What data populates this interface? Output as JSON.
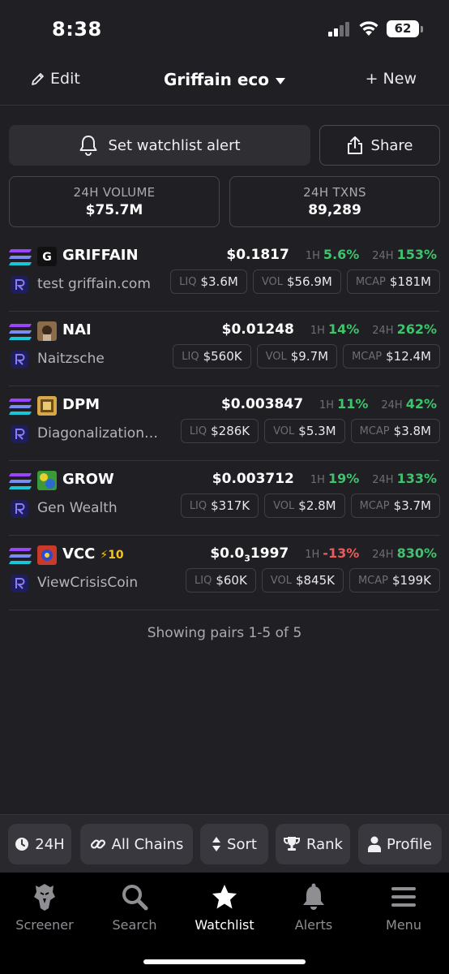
{
  "status_bar": {
    "time": "8:38",
    "battery": "62"
  },
  "header": {
    "edit_label": "Edit",
    "title": "Griffain eco",
    "new_label": "+ New"
  },
  "actions": {
    "alert_label": "Set watchlist alert",
    "share_label": "Share"
  },
  "stats": [
    {
      "label": "24H VOLUME",
      "value": "$75.7M"
    },
    {
      "label": "24H TXNS",
      "value": "89,289"
    }
  ],
  "pairs": [
    {
      "symbol": "GRIFFAIN",
      "boost": "",
      "name": "test griffain.com",
      "price": "$0.1817",
      "price_sub": "",
      "price_tail": "",
      "h1_label": "1H",
      "h1": "5.6%",
      "h1_dir": "pos",
      "h24_label": "24H",
      "h24": "153%",
      "h24_dir": "pos",
      "liq": "$3.6M",
      "vol": "$56.9M",
      "mcap": "$181M"
    },
    {
      "symbol": "NAI",
      "boost": "",
      "name": "Naitzsche",
      "price": "$0.01248",
      "price_sub": "",
      "price_tail": "",
      "h1_label": "1H",
      "h1": "14%",
      "h1_dir": "pos",
      "h24_label": "24H",
      "h24": "262%",
      "h24_dir": "pos",
      "liq": "$560K",
      "vol": "$9.7M",
      "mcap": "$12.4M"
    },
    {
      "symbol": "DPM",
      "boost": "",
      "name": "Diagonalization…",
      "price": "$0.003847",
      "price_sub": "",
      "price_tail": "",
      "h1_label": "1H",
      "h1": "11%",
      "h1_dir": "pos",
      "h24_label": "24H",
      "h24": "42%",
      "h24_dir": "pos",
      "liq": "$286K",
      "vol": "$5.3M",
      "mcap": "$3.8M"
    },
    {
      "symbol": "GROW",
      "boost": "",
      "name": "Gen Wealth",
      "price": "$0.003712",
      "price_sub": "",
      "price_tail": "",
      "h1_label": "1H",
      "h1": "19%",
      "h1_dir": "pos",
      "h24_label": "24H",
      "h24": "133%",
      "h24_dir": "pos",
      "liq": "$317K",
      "vol": "$2.8M",
      "mcap": "$3.7M"
    },
    {
      "symbol": "VCC",
      "boost": "⚡10",
      "name": "ViewCrisisCoin",
      "price": "$0.0",
      "price_sub": "3",
      "price_tail": "1997",
      "h1_label": "1H",
      "h1": "-13%",
      "h1_dir": "neg",
      "h24_label": "24H",
      "h24": "830%",
      "h24_dir": "pos",
      "liq": "$60K",
      "vol": "$845K",
      "mcap": "$199K"
    }
  ],
  "chip_labels": {
    "liq": "LIQ",
    "vol": "VOL",
    "mcap": "MCAP"
  },
  "showing": "Showing pairs 1-5 of 5",
  "filters": {
    "timeframe": "24H",
    "chains": "All Chains",
    "sort": "Sort",
    "rank": "Rank",
    "profile": "Profile"
  },
  "tabs": [
    {
      "label": "Screener",
      "icon": "eagle-icon"
    },
    {
      "label": "Search",
      "icon": "search-icon"
    },
    {
      "label": "Watchlist",
      "icon": "star-icon",
      "active": true
    },
    {
      "label": "Alerts",
      "icon": "bell-icon"
    },
    {
      "label": "Menu",
      "icon": "menu-icon"
    }
  ],
  "colors": {
    "positive": "#3ec46d",
    "negative": "#ec5a5a",
    "background": "#1f1f24",
    "boost": "#f5c518"
  }
}
